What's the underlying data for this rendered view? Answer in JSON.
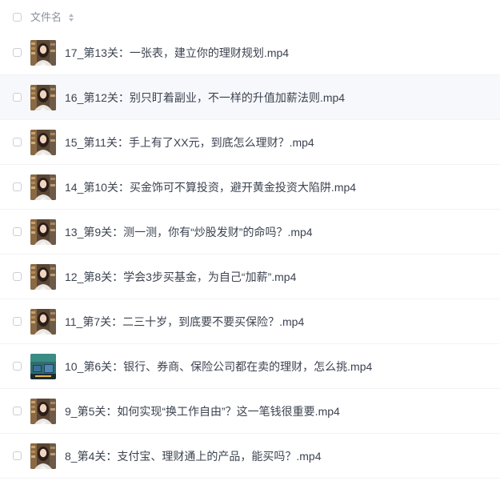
{
  "header": {
    "column_label": "文件名",
    "sort_icon": "sort-icon"
  },
  "colors": {
    "hover_row": "#f7f8fb",
    "text": "#3c4350",
    "header_text": "#8b919c",
    "checkbox_border": "#c9ced6"
  },
  "files": [
    {
      "name": "17_第13关：一张表，建立你的理财规划.mp4",
      "thumbnail": "video-thumbnail-person"
    },
    {
      "name": "16_第12关：别只盯着副业，不一样的升值加薪法则.mp4",
      "thumbnail": "video-thumbnail-person",
      "hover": true
    },
    {
      "name": "15_第11关：手上有了XX元，到底怎么理财？.mp4",
      "thumbnail": "video-thumbnail-person"
    },
    {
      "name": "14_第10关：买金饰可不算投资，避开黄金投资大陷阱.mp4",
      "thumbnail": "video-thumbnail-person"
    },
    {
      "name": "13_第9关：测一测，你有“炒股发财”的命吗？.mp4",
      "thumbnail": "video-thumbnail-person"
    },
    {
      "name": "12_第8关：学会3步买基金，为自己“加薪”.mp4",
      "thumbnail": "video-thumbnail-person"
    },
    {
      "name": "11_第7关：二三十岁，到底要不要买保险？.mp4",
      "thumbnail": "video-thumbnail-person"
    },
    {
      "name": "10_第6关：银行、券商、保险公司都在卖的理财，怎么挑.mp4",
      "thumbnail": "video-thumbnail-screen"
    },
    {
      "name": "9_第5关：如何实现“换工作自由”？这一笔钱很重要.mp4",
      "thumbnail": "video-thumbnail-person"
    },
    {
      "name": "8_第4关：支付宝、理财通上的产品，能买吗？.mp4",
      "thumbnail": "video-thumbnail-person"
    }
  ]
}
